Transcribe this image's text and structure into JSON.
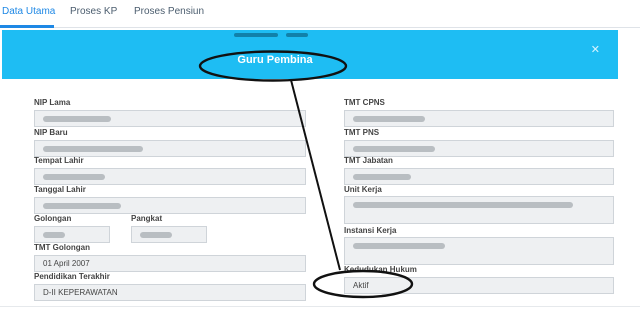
{
  "tabs": [
    {
      "label": "Data Utama",
      "active": true
    },
    {
      "label": "Proses KP",
      "active": false
    },
    {
      "label": "Proses Pensiun",
      "active": false
    }
  ],
  "banner": {
    "role": "Guru Pembina",
    "close_icon": "close-icon",
    "color": "#1ebdf3"
  },
  "form": {
    "left": {
      "nip_lama": {
        "label": "NIP Lama",
        "value": ""
      },
      "nip_baru": {
        "label": "NIP Baru",
        "value": ""
      },
      "tempat_lahir": {
        "label": "Tempat Lahir",
        "value": ""
      },
      "tanggal_lahir": {
        "label": "Tanggal Lahir",
        "value": ""
      },
      "golongan": {
        "label": "Golongan",
        "value": ""
      },
      "pangkat": {
        "label": "Pangkat",
        "value": ""
      },
      "tmt_golongan": {
        "label": "TMT Golongan",
        "value": "01 April 2007"
      },
      "pendidikan": {
        "label": "Pendidikan Terakhir",
        "value": "D-II KEPERAWATAN"
      }
    },
    "right": {
      "tmt_cpns": {
        "label": "TMT CPNS",
        "value": ""
      },
      "tmt_pns": {
        "label": "TMT PNS",
        "value": ""
      },
      "tmt_jabatan": {
        "label": "TMT Jabatan",
        "value": ""
      },
      "unit_kerja": {
        "label": "Unit Kerja",
        "value": ""
      },
      "instansi_kerja": {
        "label": "Instansi Kerja",
        "value": ""
      },
      "kedudukan_hukum": {
        "label": "Kedudukan Hukum",
        "value": "Aktif"
      }
    }
  },
  "annotation": {
    "color": "#111111"
  }
}
